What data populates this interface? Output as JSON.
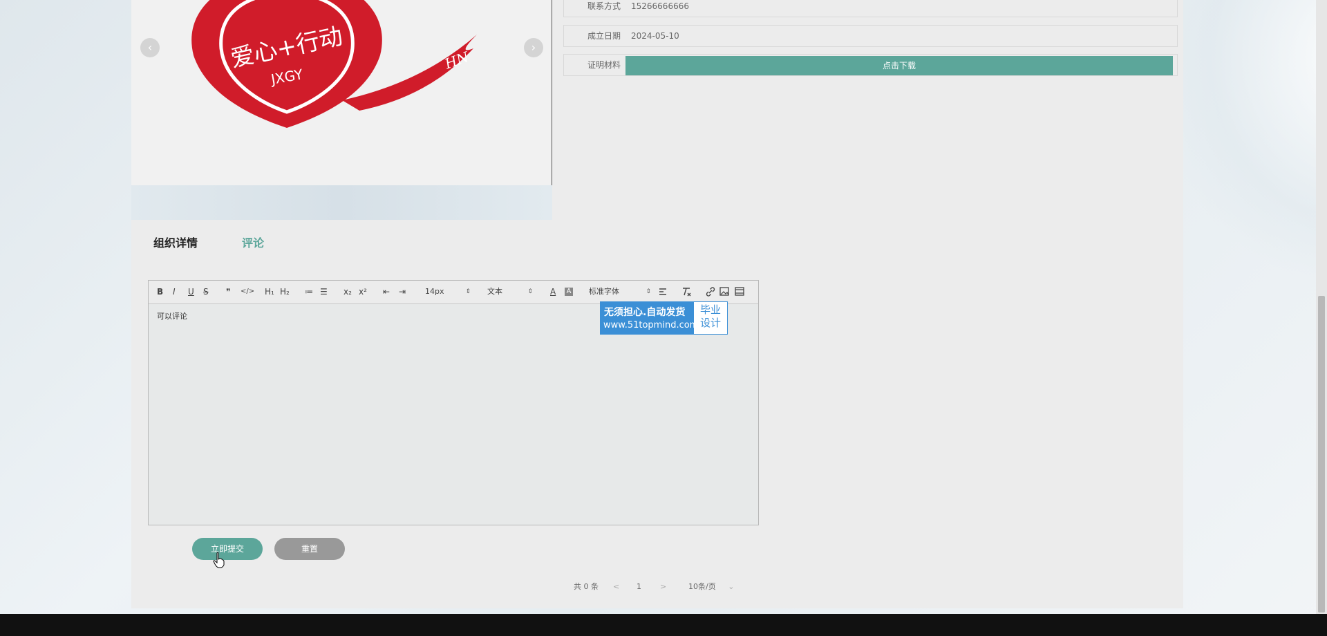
{
  "org_info": {
    "contact": {
      "label": "联系方式",
      "value": "15266666666"
    },
    "founded": {
      "label": "成立日期",
      "value": "2024-05-10"
    },
    "proof": {
      "label": "证明材料",
      "button": "点击下载"
    }
  },
  "carousel": {
    "logo_text": "爱心+行动",
    "logo_sub": "JXGY",
    "logo_sign": "HN",
    "prev_icon": "‹",
    "next_icon": "›"
  },
  "tabs": [
    {
      "label": "组织详情",
      "active": true
    },
    {
      "label": "评论",
      "active": false
    }
  ],
  "editor": {
    "toolbar": {
      "bold": "B",
      "italic": "I",
      "underline": "U",
      "strike": "S",
      "quote": "❞",
      "code": "</>",
      "h1": "H₁",
      "h2": "H₂",
      "ordered_list": "≔",
      "bullet_list": "☰",
      "subscript": "x₂",
      "superscript": "x²",
      "outdent": "⇤",
      "indent": "⇥",
      "font_size": "14px",
      "block_type": "文本",
      "font_family": "标准字体",
      "text_color": "A",
      "bg_color": "A"
    },
    "content": "可以评论"
  },
  "watermark": {
    "line1": "无须担心.自动发货",
    "line2": "www.51topmind.com",
    "right_line1": "毕业",
    "right_line2": "设计"
  },
  "buttons": {
    "submit": "立即提交",
    "reset": "重置"
  },
  "pagination": {
    "total": "共 0 条",
    "prev": "<",
    "page": "1",
    "next": ">",
    "per_page": "10条/页",
    "dropdown_icon": "⌄"
  },
  "colors": {
    "primary": "#5ca69a",
    "reset_btn": "#999999",
    "watermark": "#3b8fd6",
    "logo_red": "#d01c2a"
  }
}
